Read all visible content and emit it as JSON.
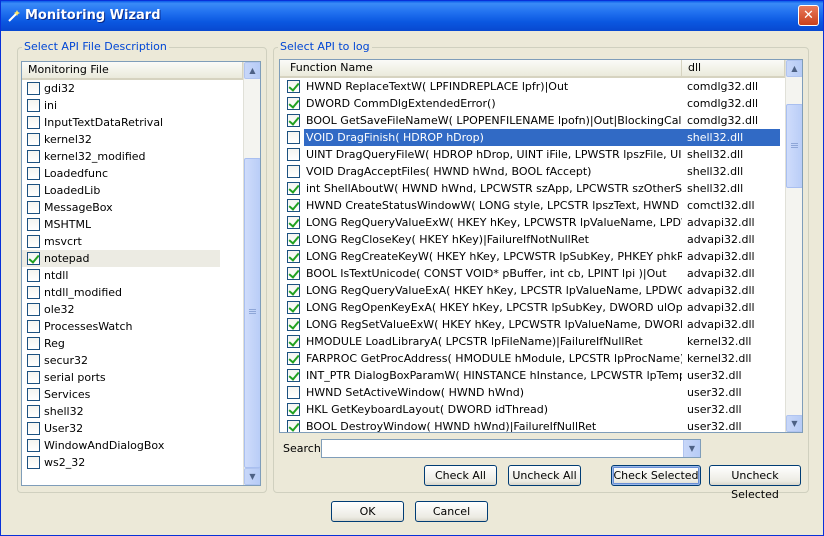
{
  "window": {
    "title": "Monitoring Wizard",
    "close_label": "✕"
  },
  "left_group": {
    "legend": "Select API File Description",
    "column": "Monitoring File",
    "items": [
      {
        "label": "gdi32",
        "checked": false
      },
      {
        "label": "ini",
        "checked": false
      },
      {
        "label": "InputTextDataRetrival",
        "checked": false
      },
      {
        "label": "kernel32",
        "checked": false
      },
      {
        "label": "kernel32_modified",
        "checked": false
      },
      {
        "label": "Loadedfunc",
        "checked": false
      },
      {
        "label": "LoadedLib",
        "checked": false
      },
      {
        "label": "MessageBox",
        "checked": false
      },
      {
        "label": "MSHTML",
        "checked": false
      },
      {
        "label": "msvcrt",
        "checked": false
      },
      {
        "label": "notepad",
        "checked": true,
        "highlight": true
      },
      {
        "label": "ntdll",
        "checked": false
      },
      {
        "label": "ntdll_modified",
        "checked": false
      },
      {
        "label": "ole32",
        "checked": false
      },
      {
        "label": "ProcessesWatch",
        "checked": false
      },
      {
        "label": "Reg",
        "checked": false
      },
      {
        "label": "secur32",
        "checked": false
      },
      {
        "label": "serial ports",
        "checked": false
      },
      {
        "label": "Services",
        "checked": false
      },
      {
        "label": "shell32",
        "checked": false
      },
      {
        "label": "User32",
        "checked": false
      },
      {
        "label": "WindowAndDialogBox",
        "checked": false
      },
      {
        "label": "ws2_32",
        "checked": false
      }
    ]
  },
  "right_group": {
    "legend": "Select API to log",
    "columns": [
      "Function Name",
      "dll"
    ],
    "rows": [
      {
        "fn": "HWND ReplaceTextW( LPFINDREPLACE lpfr)|Out",
        "dll": "comdlg32.dll",
        "checked": true
      },
      {
        "fn": "DWORD CommDlgExtendedError()",
        "dll": "comdlg32.dll",
        "checked": true
      },
      {
        "fn": "BOOL GetSaveFileNameW( LPOPENFILENAME lpofn)|Out|BlockingCall",
        "dll": "comdlg32.dll",
        "checked": true
      },
      {
        "fn": "VOID DragFinish( HDROP hDrop)",
        "dll": "shell32.dll",
        "checked": false,
        "selected": true
      },
      {
        "fn": "UINT DragQueryFileW( HDROP hDrop, UINT iFile, LPWSTR lpszFile, UINT cc...",
        "dll": "shell32.dll",
        "checked": false
      },
      {
        "fn": "VOID DragAcceptFiles( HWND hWnd, BOOL fAccept)",
        "dll": "shell32.dll",
        "checked": false
      },
      {
        "fn": "int ShellAboutW( HWND hWnd, LPCWSTR szApp, LPCWSTR szOtherStuff, ...",
        "dll": "shell32.dll",
        "checked": true
      },
      {
        "fn": "HWND CreateStatusWindowW( LONG style, LPCSTR  lpszText, HWND hwn...",
        "dll": "comctl32.dll",
        "checked": true
      },
      {
        "fn": "LONG RegQueryValueExW( HKEY hKey, LPCWSTR lpValueName, LPDWORD...",
        "dll": "advapi32.dll",
        "checked": true
      },
      {
        "fn": "LONG RegCloseKey( HKEY hKey)|FailureIfNotNullRet",
        "dll": "advapi32.dll",
        "checked": true
      },
      {
        "fn": "LONG RegCreateKeyW( HKEY hKey, LPCWSTR lpSubKey, PHKEY phkResult...",
        "dll": "advapi32.dll",
        "checked": true
      },
      {
        "fn": "BOOL IsTextUnicode( CONST VOID* pBuffer, int cb, LPINT lpi )|Out",
        "dll": "advapi32.dll",
        "checked": true
      },
      {
        "fn": "LONG RegQueryValueExA( HKEY hKey, LPCSTR  lpValueName, LPDWORD l...",
        "dll": "advapi32.dll",
        "checked": true
      },
      {
        "fn": "LONG RegOpenKeyExA( HKEY hKey, LPCSTR  lpSubKey, DWORD ulOptions...",
        "dll": "advapi32.dll",
        "checked": true
      },
      {
        "fn": "LONG RegSetValueExW( HKEY hKey, LPCWSTR lpValueName, DWORD Res...",
        "dll": "advapi32.dll",
        "checked": true
      },
      {
        "fn": "HMODULE LoadLibraryA( LPCSTR  lpFileName)|FailureIfNullRet",
        "dll": "kernel32.dll",
        "checked": true
      },
      {
        "fn": "FARPROC GetProcAddress( HMODULE hModule, LPCSTR lpProcName)|Failu...",
        "dll": "kernel32.dll",
        "checked": true
      },
      {
        "fn": "INT_PTR DialogBoxParamW( HINSTANCE hInstance, LPCWSTR lpTemplate...",
        "dll": "user32.dll",
        "checked": true
      },
      {
        "fn": "HWND SetActiveWindow( HWND hWnd)",
        "dll": "user32.dll",
        "checked": false
      },
      {
        "fn": "HKL GetKeyboardLayout( DWORD idThread)",
        "dll": "user32.dll",
        "checked": true
      },
      {
        "fn": "BOOL DestroyWindow( HWND hWnd)|FailureIfNullRet",
        "dll": "user32.dll",
        "checked": true
      }
    ]
  },
  "search": {
    "label": "Search",
    "value": ""
  },
  "buttons": {
    "check_all": "Check All",
    "uncheck_all": "Uncheck All",
    "check_selected": "Check Selected",
    "uncheck_selected": "Uncheck Selected",
    "ok": "OK",
    "cancel": "Cancel"
  },
  "icons": {
    "scroll_up": "▲",
    "scroll_down": "▼",
    "dropdown": "▼"
  }
}
